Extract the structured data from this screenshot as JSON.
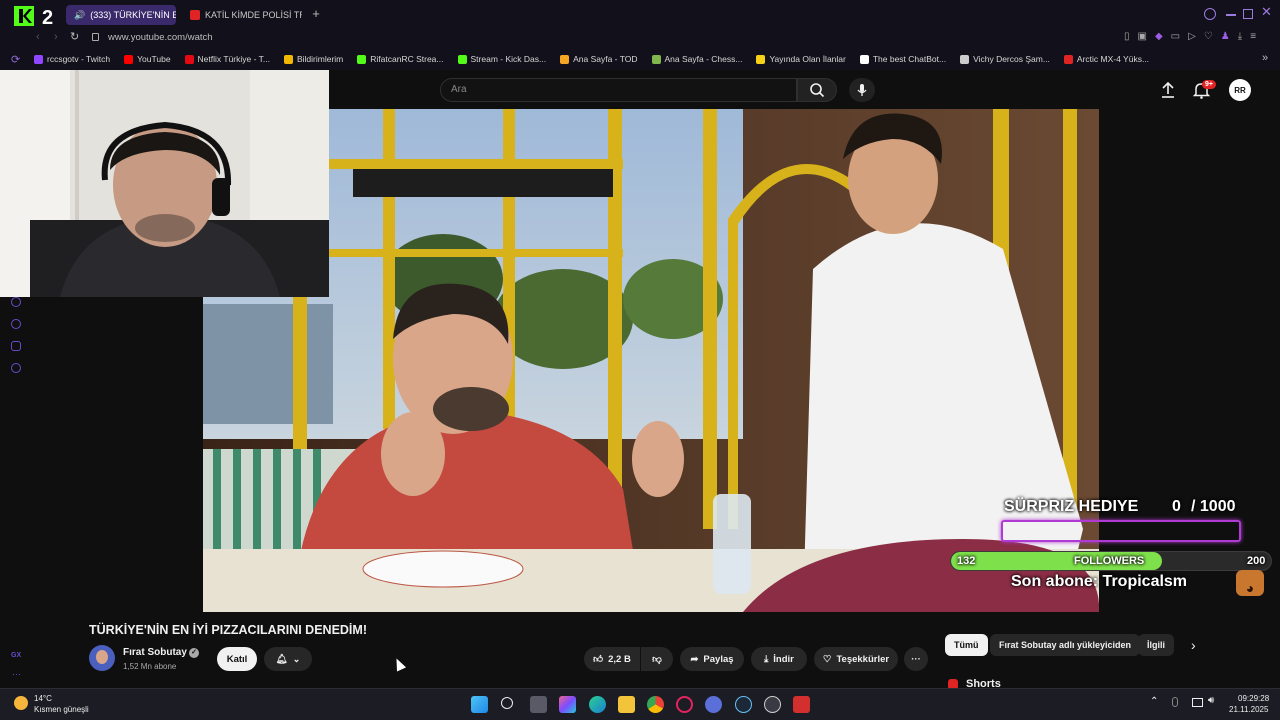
{
  "browser": {
    "tabs": [
      {
        "label": "(333) TÜRKİYE'NİN E",
        "active": true
      },
      {
        "label": "KATİL KİMDE POLİSİ TRO",
        "active": false
      }
    ],
    "url": "www.youtube.com/watch",
    "bookmarks": [
      {
        "label": "rccsgotv - Twitch",
        "color": "#9146ff"
      },
      {
        "label": "YouTube",
        "color": "#ff0000"
      },
      {
        "label": "Netflix Türkiye - T...",
        "color": "#e50914"
      },
      {
        "label": "Bildirimlerim",
        "color": "#f2b705"
      },
      {
        "label": "RifatcanRC Strea...",
        "color": "#53fc18"
      },
      {
        "label": "Stream - Kick Das...",
        "color": "#53fc18"
      },
      {
        "label": "Ana Sayfa - TOD",
        "color": "#f5a623"
      },
      {
        "label": "Ana Sayfa - Chess...",
        "color": "#81b64c"
      },
      {
        "label": "Yayında Olan İlanlar",
        "color": "#f7d117"
      },
      {
        "label": "The best ChatBot...",
        "color": "#ffffff"
      },
      {
        "label": "Vichy Dercos Şam...",
        "color": "#cccccc"
      },
      {
        "label": "Arctic MX-4 Yüks...",
        "color": "#e02424"
      }
    ]
  },
  "youtube": {
    "search_placeholder": "Ara",
    "notification_badge": "9+",
    "avatar_initials": "RR"
  },
  "overlay": {
    "gift_label": "SÜRPRIZ HEDIYE",
    "gift_current": "0",
    "gift_total": "/ 1000",
    "followers_current": "132",
    "followers_label": "FOLLOWERS",
    "followers_goal": "200",
    "followers_progress": 0.66,
    "last_sub": "Son abone: Tropicalsm"
  },
  "video": {
    "title": "TÜRKİYE'NİN EN İYİ PIZZACILARINI DENEDİM!",
    "channel": "Fırat Sobutay",
    "subscribers": "1,52 Mn abone",
    "join_label": "Katıl",
    "likes": "2,2 B",
    "share_label": "Paylaş",
    "download_label": "İndir",
    "thanks_label": "Teşekkürler"
  },
  "chips": [
    "Tümü",
    "Fırat Sobutay adlı yükleyiciden",
    "İlgili"
  ],
  "shorts_label": "Shorts",
  "sidebar_label": "GX",
  "taskbar": {
    "weather_temp": "14°C",
    "weather_desc": "Kısmen güneşli",
    "time": "09:29:28",
    "date": "21.11.2025"
  },
  "colors": {
    "accent_purple": "#9b30d9",
    "followers_green": "#7ee04a",
    "tab_active": "#3b2a6b"
  }
}
